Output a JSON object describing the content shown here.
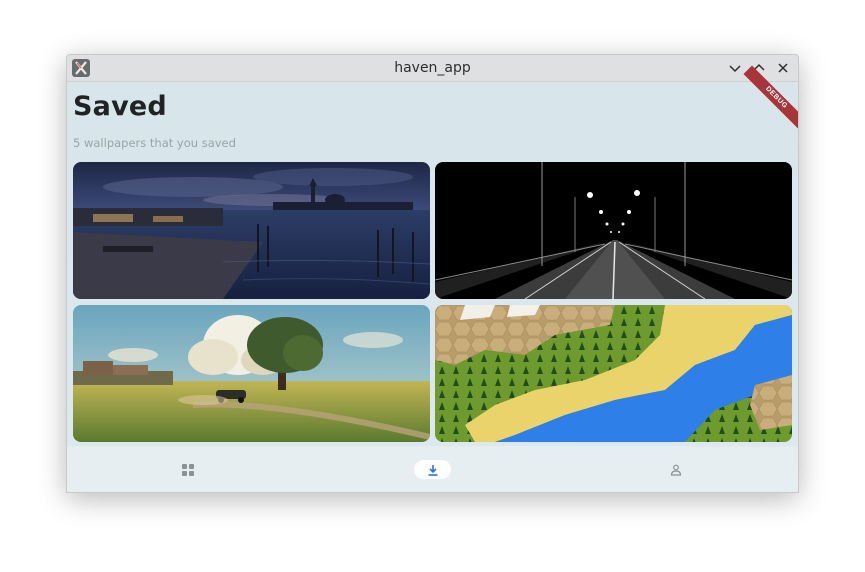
{
  "window": {
    "title": "haven_app",
    "app_icon": "x-app-icon",
    "controls": [
      "chevron-down-icon",
      "chevron-up-icon",
      "close-icon"
    ]
  },
  "page": {
    "title": "Saved",
    "subtitle": "5 wallpapers that you saved",
    "debug_banner": "DEBUG"
  },
  "wallpapers": [
    {
      "name": "venice-dusk-waterfront",
      "palette": [
        "#2a3557",
        "#4b5a86",
        "#1b2238"
      ]
    },
    {
      "name": "night-highway-streetlights",
      "palette": [
        "#000000",
        "#3a3a3a",
        "#ffffff"
      ]
    },
    {
      "name": "countryside-car-field-tree",
      "palette": [
        "#8fb9c9",
        "#c8b860",
        "#6d8a3c"
      ]
    },
    {
      "name": "hexagon-island-map",
      "palette": [
        "#2f7fe0",
        "#d9c98a",
        "#4f8a2a"
      ]
    }
  ],
  "bottom_nav": {
    "items": [
      {
        "name": "grid-icon",
        "active": false
      },
      {
        "name": "download-icon",
        "active": true
      },
      {
        "name": "person-icon",
        "active": false
      }
    ],
    "accent": "#2f6fe0",
    "inactive": "#8a9296"
  }
}
